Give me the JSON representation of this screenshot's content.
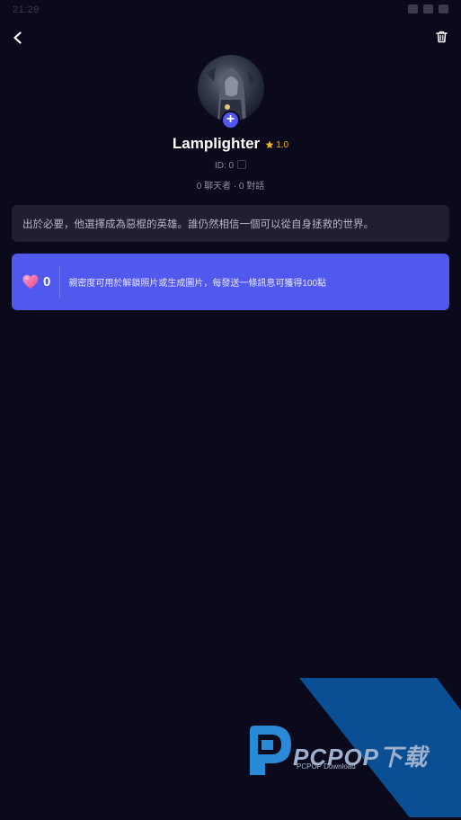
{
  "status_bar": {
    "time": "21:29"
  },
  "header": {
    "back_icon": "chevron-left-icon",
    "delete_icon": "trash-icon"
  },
  "profile": {
    "name": "Lamplighter",
    "rating": "1.0",
    "rating_color": "#f1b418",
    "id_text": "ID: 0",
    "stats_text": "0 聊天者 · 0 對話",
    "add_avatar_label": "+"
  },
  "description": {
    "text": "出於必要，他選擇成為惡棍的英雄。誰仍然相信一個可以從自身拯救的世界。"
  },
  "intimacy": {
    "value": "0",
    "note": "親密度可用於解鎖照片或生成圖片，每發送一條訊息可獲得100點",
    "accent_color": "#5058ee"
  },
  "watermark": {
    "title": "PCPOP下载",
    "subtitle": "PCPOP Download"
  }
}
